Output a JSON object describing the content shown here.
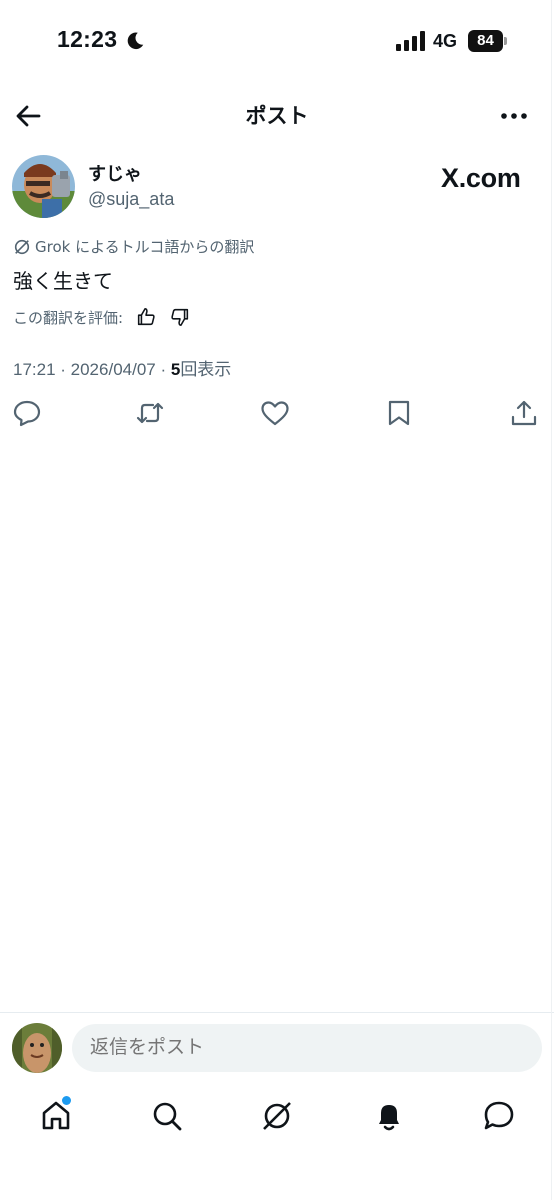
{
  "status_bar": {
    "time": "12:23",
    "network": "4G",
    "battery": "84"
  },
  "header": {
    "title": "ポスト",
    "back_icon": "arrow-left-icon",
    "more_icon": "more-horizontal-icon"
  },
  "post": {
    "display_name": "すじゃ",
    "handle": "@suja_ata",
    "watermark": "X.com",
    "translation_note": "Grok によるトルコ語からの翻訳",
    "text": "強く生きて",
    "rate_label": "この翻訳を評価:",
    "timestamp": "17:21 · 2026/04/07 · ",
    "views_count": "5",
    "views_label": "回表示"
  },
  "actions": [
    "reply-icon",
    "repost-icon",
    "like-icon",
    "bookmark-icon",
    "share-icon"
  ],
  "reply": {
    "placeholder": "返信をポスト"
  },
  "tabbar": {
    "tabs": [
      "home-icon",
      "search-icon",
      "grok-icon",
      "notifications-icon",
      "messages-icon"
    ],
    "has_unread_dot": true
  },
  "colors": {
    "text": "#0f1419",
    "secondary": "#536471",
    "accent": "#1d9bf0",
    "input_bg": "#eff3f4"
  }
}
